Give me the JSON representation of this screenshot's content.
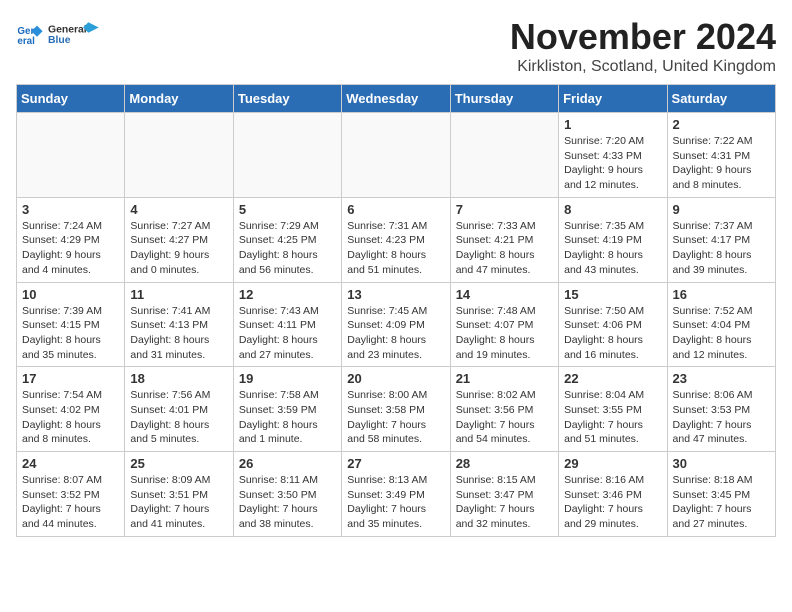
{
  "logo": {
    "line1": "General",
    "line2": "Blue"
  },
  "title": "November 2024",
  "location": "Kirkliston, Scotland, United Kingdom",
  "weekdays": [
    "Sunday",
    "Monday",
    "Tuesday",
    "Wednesday",
    "Thursday",
    "Friday",
    "Saturday"
  ],
  "weeks": [
    [
      {
        "day": "",
        "info": ""
      },
      {
        "day": "",
        "info": ""
      },
      {
        "day": "",
        "info": ""
      },
      {
        "day": "",
        "info": ""
      },
      {
        "day": "",
        "info": ""
      },
      {
        "day": "1",
        "info": "Sunrise: 7:20 AM\nSunset: 4:33 PM\nDaylight: 9 hours\nand 12 minutes."
      },
      {
        "day": "2",
        "info": "Sunrise: 7:22 AM\nSunset: 4:31 PM\nDaylight: 9 hours\nand 8 minutes."
      }
    ],
    [
      {
        "day": "3",
        "info": "Sunrise: 7:24 AM\nSunset: 4:29 PM\nDaylight: 9 hours\nand 4 minutes."
      },
      {
        "day": "4",
        "info": "Sunrise: 7:27 AM\nSunset: 4:27 PM\nDaylight: 9 hours\nand 0 minutes."
      },
      {
        "day": "5",
        "info": "Sunrise: 7:29 AM\nSunset: 4:25 PM\nDaylight: 8 hours\nand 56 minutes."
      },
      {
        "day": "6",
        "info": "Sunrise: 7:31 AM\nSunset: 4:23 PM\nDaylight: 8 hours\nand 51 minutes."
      },
      {
        "day": "7",
        "info": "Sunrise: 7:33 AM\nSunset: 4:21 PM\nDaylight: 8 hours\nand 47 minutes."
      },
      {
        "day": "8",
        "info": "Sunrise: 7:35 AM\nSunset: 4:19 PM\nDaylight: 8 hours\nand 43 minutes."
      },
      {
        "day": "9",
        "info": "Sunrise: 7:37 AM\nSunset: 4:17 PM\nDaylight: 8 hours\nand 39 minutes."
      }
    ],
    [
      {
        "day": "10",
        "info": "Sunrise: 7:39 AM\nSunset: 4:15 PM\nDaylight: 8 hours\nand 35 minutes."
      },
      {
        "day": "11",
        "info": "Sunrise: 7:41 AM\nSunset: 4:13 PM\nDaylight: 8 hours\nand 31 minutes."
      },
      {
        "day": "12",
        "info": "Sunrise: 7:43 AM\nSunset: 4:11 PM\nDaylight: 8 hours\nand 27 minutes."
      },
      {
        "day": "13",
        "info": "Sunrise: 7:45 AM\nSunset: 4:09 PM\nDaylight: 8 hours\nand 23 minutes."
      },
      {
        "day": "14",
        "info": "Sunrise: 7:48 AM\nSunset: 4:07 PM\nDaylight: 8 hours\nand 19 minutes."
      },
      {
        "day": "15",
        "info": "Sunrise: 7:50 AM\nSunset: 4:06 PM\nDaylight: 8 hours\nand 16 minutes."
      },
      {
        "day": "16",
        "info": "Sunrise: 7:52 AM\nSunset: 4:04 PM\nDaylight: 8 hours\nand 12 minutes."
      }
    ],
    [
      {
        "day": "17",
        "info": "Sunrise: 7:54 AM\nSunset: 4:02 PM\nDaylight: 8 hours\nand 8 minutes."
      },
      {
        "day": "18",
        "info": "Sunrise: 7:56 AM\nSunset: 4:01 PM\nDaylight: 8 hours\nand 5 minutes."
      },
      {
        "day": "19",
        "info": "Sunrise: 7:58 AM\nSunset: 3:59 PM\nDaylight: 8 hours\nand 1 minute."
      },
      {
        "day": "20",
        "info": "Sunrise: 8:00 AM\nSunset: 3:58 PM\nDaylight: 7 hours\nand 58 minutes."
      },
      {
        "day": "21",
        "info": "Sunrise: 8:02 AM\nSunset: 3:56 PM\nDaylight: 7 hours\nand 54 minutes."
      },
      {
        "day": "22",
        "info": "Sunrise: 8:04 AM\nSunset: 3:55 PM\nDaylight: 7 hours\nand 51 minutes."
      },
      {
        "day": "23",
        "info": "Sunrise: 8:06 AM\nSunset: 3:53 PM\nDaylight: 7 hours\nand 47 minutes."
      }
    ],
    [
      {
        "day": "24",
        "info": "Sunrise: 8:07 AM\nSunset: 3:52 PM\nDaylight: 7 hours\nand 44 minutes."
      },
      {
        "day": "25",
        "info": "Sunrise: 8:09 AM\nSunset: 3:51 PM\nDaylight: 7 hours\nand 41 minutes."
      },
      {
        "day": "26",
        "info": "Sunrise: 8:11 AM\nSunset: 3:50 PM\nDaylight: 7 hours\nand 38 minutes."
      },
      {
        "day": "27",
        "info": "Sunrise: 8:13 AM\nSunset: 3:49 PM\nDaylight: 7 hours\nand 35 minutes."
      },
      {
        "day": "28",
        "info": "Sunrise: 8:15 AM\nSunset: 3:47 PM\nDaylight: 7 hours\nand 32 minutes."
      },
      {
        "day": "29",
        "info": "Sunrise: 8:16 AM\nSunset: 3:46 PM\nDaylight: 7 hours\nand 29 minutes."
      },
      {
        "day": "30",
        "info": "Sunrise: 8:18 AM\nSunset: 3:45 PM\nDaylight: 7 hours\nand 27 minutes."
      }
    ]
  ]
}
